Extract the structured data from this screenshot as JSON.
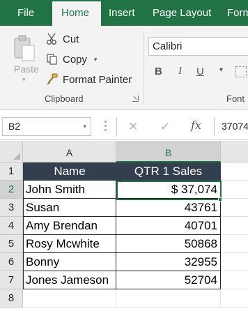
{
  "ribbon_tabs": [
    {
      "label": "File"
    },
    {
      "label": "Home"
    },
    {
      "label": "Insert"
    },
    {
      "label": "Page Layout"
    },
    {
      "label": "Form"
    }
  ],
  "active_tab": "Home",
  "clipboard": {
    "paste_label": "Paste",
    "cut_label": "Cut",
    "copy_label": "Copy",
    "format_painter_label": "Format Painter",
    "group_label": "Clipboard"
  },
  "font": {
    "name": "Calibri",
    "bold": "B",
    "italic": "I",
    "underline": "U",
    "group_label": "Font"
  },
  "formula_bar": {
    "name_box": "B2",
    "fx_label": "fx",
    "formula_value": "37074"
  },
  "columns": [
    {
      "label": "A"
    },
    {
      "label": "B"
    }
  ],
  "rows": [
    "1",
    "2",
    "3",
    "4",
    "5",
    "6",
    "7",
    "8"
  ],
  "table": {
    "headers": [
      "Name",
      "QTR 1 Sales"
    ],
    "records": [
      [
        "John Smith",
        "$ 37,074"
      ],
      [
        "Susan",
        "43761"
      ],
      [
        "Amy Brendan",
        "40701"
      ],
      [
        "Rosy Mcwhite",
        "50868"
      ],
      [
        "Bonny",
        "32955"
      ],
      [
        "Jones Jameson",
        "52704"
      ]
    ]
  },
  "selected_cell": "B2",
  "colors": {
    "accent": "#217346",
    "header_fill": "#333F4F",
    "header_text": "#FFFFFF"
  }
}
